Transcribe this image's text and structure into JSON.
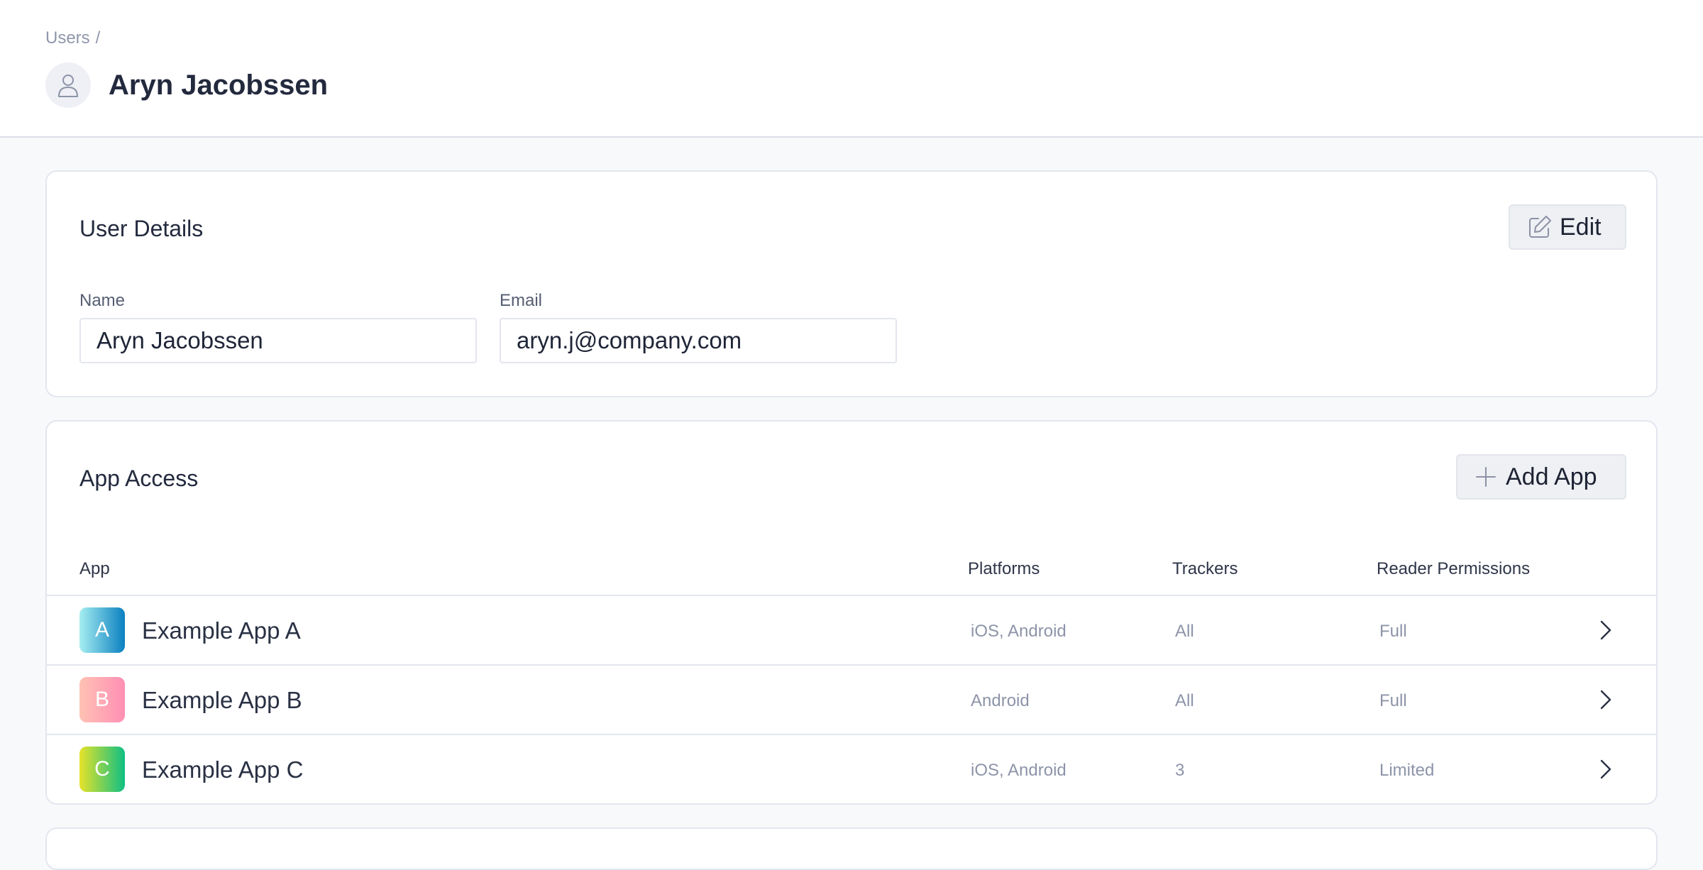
{
  "breadcrumb": {
    "parent": "Users",
    "separator": "/"
  },
  "user": {
    "name": "Aryn Jacobssen"
  },
  "details": {
    "title": "User Details",
    "edit_label": "Edit",
    "name_label": "Name",
    "name_value": "Aryn Jacobssen",
    "email_label": "Email",
    "email_value": "aryn.j@company.com"
  },
  "access": {
    "title": "App Access",
    "add_label": "Add App",
    "columns": [
      "App",
      "Platforms",
      "Trackers",
      "Reader Permissions"
    ],
    "rows": [
      {
        "letter": "A",
        "name": "Example App A",
        "platforms": "iOS, Android",
        "trackers": "All",
        "permissions": "Full"
      },
      {
        "letter": "B",
        "name": "Example App B",
        "platforms": "Android",
        "trackers": "All",
        "permissions": "Full"
      },
      {
        "letter": "C",
        "name": "Example App C",
        "platforms": "iOS, Android",
        "trackers": "3",
        "permissions": "Limited"
      }
    ]
  },
  "icons": {
    "avatar": "user-icon",
    "edit": "pencil-square-icon",
    "add": "plus-icon",
    "row": "chevron-right-icon"
  },
  "colors": {
    "app_a": [
      "#a6eef0",
      "#0a7fc0"
    ],
    "app_b": [
      "#ffc2b3",
      "#ff8fb5"
    ],
    "app_c": [
      "#e6e22a",
      "#0fbf84"
    ]
  }
}
